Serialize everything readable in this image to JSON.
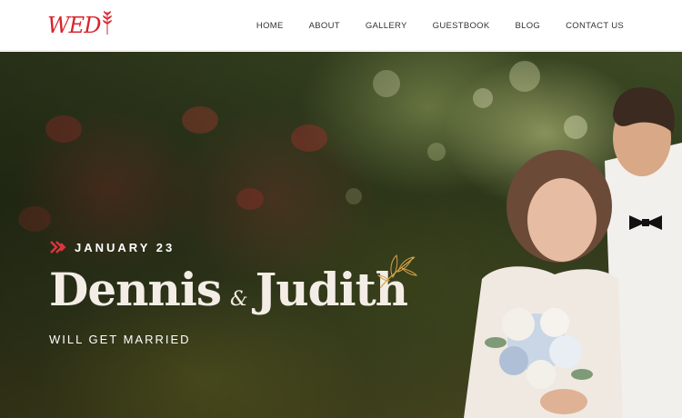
{
  "brand": {
    "logo_text": "WED",
    "accent_color": "#d9232d",
    "logo_icon": "wheat-leaf-icon"
  },
  "nav": {
    "items": [
      {
        "label": "HOME"
      },
      {
        "label": "ABOUT"
      },
      {
        "label": "GALLERY"
      },
      {
        "label": "GUESTBOOK"
      },
      {
        "label": "BLOG"
      },
      {
        "label": "CONTACT US"
      }
    ]
  },
  "hero": {
    "date": "JANUARY 23",
    "date_icon": "chevron-arrows-icon",
    "name_one": "Dennis",
    "ampersand": "&",
    "name_two": "Judith",
    "tagline": "WILL GET MARRIED",
    "decoration_icon": "leaf-ornament-icon",
    "photo": "couple-photo"
  }
}
